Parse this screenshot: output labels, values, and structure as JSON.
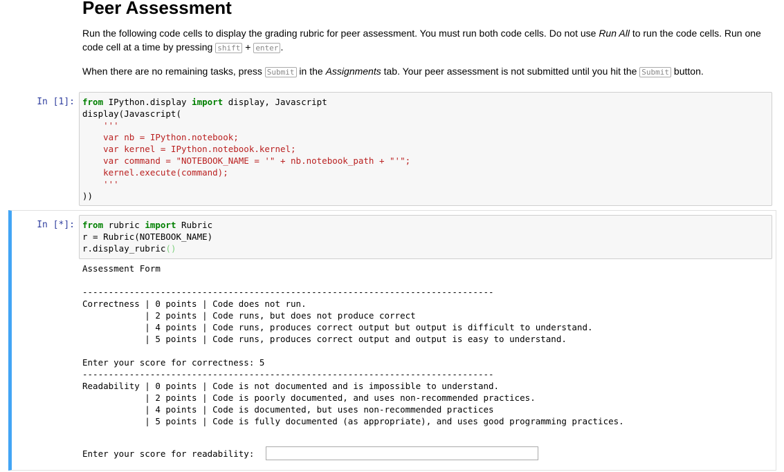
{
  "title": "Peer Assessment",
  "intro": {
    "p1_a": "Run the following code cells to display the grading rubric for peer assessment. You must run both code cells. Do not use ",
    "p1_run_all": "Run All",
    "p1_b": " to run the code cells. Run one code cell at a time by pressing ",
    "key_shift": "shift",
    "plus": " + ",
    "key_enter": "enter",
    "period": ".",
    "p2_a": "When there are no remaining tasks, press ",
    "key_submit": "Submit",
    "p2_b": " in the ",
    "assignments": "Assignments",
    "p2_c": " tab. Your peer assessment is not submitted until you hit the ",
    "p2_d": " button."
  },
  "cell1": {
    "prompt": "In [1]:",
    "line1_from": "from",
    "line1_mod": " IPython.display ",
    "line1_import": "import",
    "line1_rest": " display, Javascript",
    "line2": "display(Javascript(",
    "js": "    '''\n    var nb = IPython.notebook;\n    var kernel = IPython.notebook.kernel;\n    var command = \"NOTEBOOK_NAME = '\" + nb.notebook_path + \"'\";\n    kernel.execute(command);\n    '''",
    "line_end": "))"
  },
  "cell2": {
    "prompt": "In [*]:",
    "line1_from": "from",
    "line1_mod": " rubric ",
    "line1_import": "import",
    "line1_rest": " Rubric",
    "line2": "r = Rubric(NOTEBOOK_NAME)",
    "line3": "r.display_rubric",
    "line3_parens": "()"
  },
  "output": {
    "heading": "Assessment Form",
    "correctness_block": "-------------------------------------------------------------------------------\nCorrectness | 0 points | Code does not run.\n            | 2 points | Code runs, but does not produce correct\n            | 4 points | Code runs, produces correct output but output is difficult to understand.\n            | 5 points | Code runs, produces correct output and output is easy to understand.\n\nEnter your score for correctness: 5",
    "readability_block": "-------------------------------------------------------------------------------\nReadability | 0 points | Code is not documented and is impossible to understand.\n            | 2 points | Code is poorly documented, and uses non-recommended practices.\n            | 4 points | Code is documented, but uses non-recommended practices\n            | 5 points | Code is fully documented (as appropriate), and uses good programming practices.",
    "readability_prompt": "Enter your score for readability:",
    "readability_value": ""
  }
}
